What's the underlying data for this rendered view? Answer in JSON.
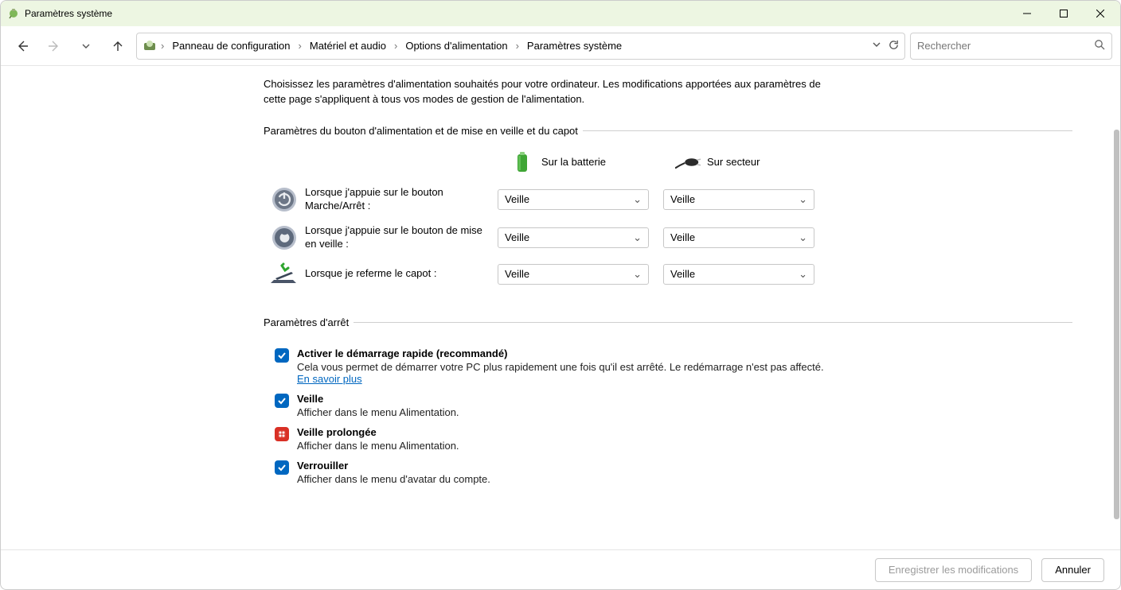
{
  "window": {
    "title": "Paramètres système"
  },
  "breadcrumb": {
    "items": [
      "Panneau de configuration",
      "Matériel et audio",
      "Options d'alimentation",
      "Paramètres système"
    ]
  },
  "search": {
    "placeholder": "Rechercher"
  },
  "intro": "Choisissez les paramètres d'alimentation souhaités pour votre ordinateur. Les modifications apportées aux paramètres de cette page s'appliquent à tous vos modes de gestion de l'alimentation.",
  "sections": {
    "buttons": {
      "legend": "Paramètres du bouton d'alimentation et de mise en veille et du capot",
      "col_battery": "Sur la batterie",
      "col_ac": "Sur secteur",
      "rows": [
        {
          "label": "Lorsque j'appuie sur le bouton Marche/Arrêt :",
          "battery": "Veille",
          "ac": "Veille"
        },
        {
          "label": "Lorsque j'appuie sur le bouton de mise en veille :",
          "battery": "Veille",
          "ac": "Veille"
        },
        {
          "label": "Lorsque je referme le capot :",
          "battery": "Veille",
          "ac": "Veille"
        }
      ]
    },
    "shutdown": {
      "legend": "Paramètres d'arrêt",
      "items": [
        {
          "title": "Activer le démarrage rapide (recommandé)",
          "desc_before": "Cela vous permet de démarrer votre PC plus rapidement une fois qu'il est arrêté. Le redémarrage n'est pas affecté. ",
          "link": "En savoir plus",
          "style": "blue"
        },
        {
          "title": "Veille",
          "desc": "Afficher dans le menu Alimentation.",
          "style": "blue"
        },
        {
          "title": "Veille prolongée",
          "desc": "Afficher dans le menu Alimentation.",
          "style": "red"
        },
        {
          "title": "Verrouiller",
          "desc": "Afficher dans le menu d'avatar du compte.",
          "style": "blue"
        }
      ]
    }
  },
  "footer": {
    "save": "Enregistrer les modifications",
    "cancel": "Annuler"
  }
}
